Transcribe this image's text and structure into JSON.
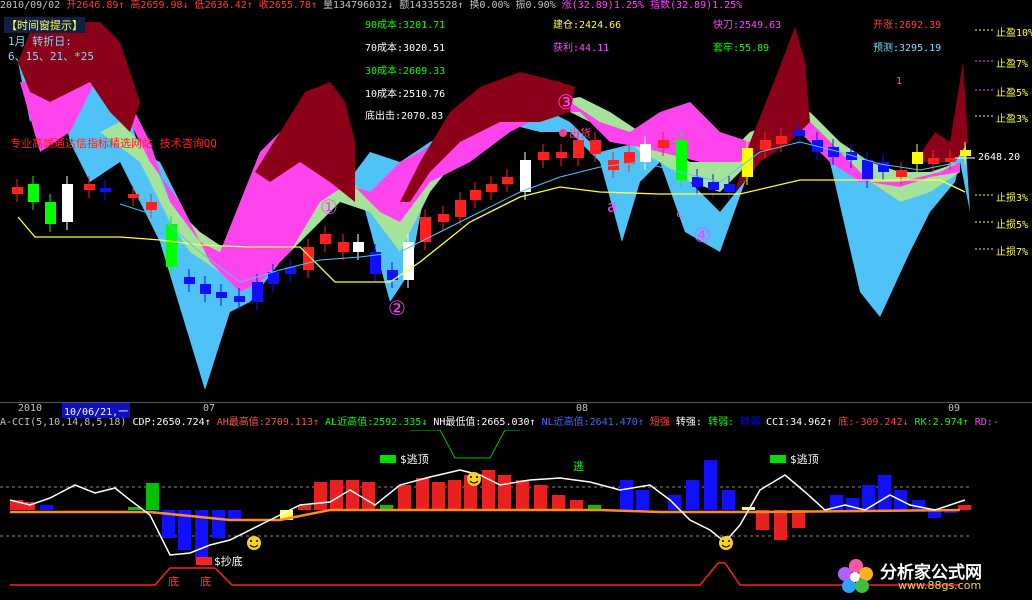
{
  "topbar": [
    {
      "text": "2010/09/02",
      "color": "#c0c0c0"
    },
    {
      "text": "开2646.89↑",
      "color": "#ff3b3b"
    },
    {
      "text": "高2659.98↓",
      "color": "#ff3b3b"
    },
    {
      "text": "低2636.42↑",
      "color": "#ff3b3b"
    },
    {
      "text": "收2655.78↑",
      "color": "#ff3b3b"
    },
    {
      "text": "量134796032↓",
      "color": "#c0c0c0"
    },
    {
      "text": "额14335528↑",
      "color": "#c0c0c0"
    },
    {
      "text": "换0.00%",
      "color": "#c0c0c0"
    },
    {
      "text": "振0.90%",
      "color": "#c0c0c0"
    },
    {
      "text": "涨(32.89)1.25%",
      "color": "#ff44ff"
    },
    {
      "text": "指数(32.89)1.25%",
      "color": "#ff44ff"
    }
  ],
  "panel": {
    "title": "【时间窗提示】",
    "line1": "1月 转折日:",
    "line2": "6、15、21、*25"
  },
  "cost": {
    "c90": "90成本:3201.71",
    "c70": "70成本:3020.51",
    "c30": "30成本:2609.33",
    "c10": "10成本:2510.76",
    "bottom": "底出击:2070.83"
  },
  "info": {
    "jiancang": "建仓:2424.66",
    "huoli": "获利:44.11",
    "kuaidao": "快刀:2549.63",
    "taolao": "套牢:55.89",
    "kaizhang": "开涨:2692.39",
    "yuce": "预测:3295.19"
  },
  "marks": {
    "stop_profit_10": "止盈10%",
    "stop_profit_7": "止盈7%",
    "stop_profit_5": "止盈5%",
    "stop_profit_3": "止盈3%",
    "current_price": "2648.20",
    "stop_loss_3": "止损3%",
    "stop_loss_5": "止损5%",
    "stop_loss_7": "止损7%",
    "digit_1": "1",
    "red_message": "专业高端通达信指标精选网站 技术咨询QQ",
    "circle1": "①",
    "circle2": "②",
    "circle3": "③",
    "circle4": "④",
    "label_a": "a",
    "label_b": "b",
    "label_c": "c",
    "chuhuo": "出货"
  },
  "dateaxis": {
    "y2010": "2010",
    "cursor": "10/06/21,一",
    "m07": "07",
    "m08": "08",
    "m09": "09"
  },
  "indicator_header": [
    {
      "text": "A-CCI(5,10,14,8,5,18)",
      "color": "#c0c0c0"
    },
    {
      "text": "CDP:2650.724↑",
      "color": "#ffffff"
    },
    {
      "text": "AH最高值:2709.113↑",
      "color": "#ff5050"
    },
    {
      "text": "AL近高值:2592.335↓",
      "color": "#00ff00"
    },
    {
      "text": "NH最低值:2665.030↑",
      "color": "#ffffff"
    },
    {
      "text": "NL近高值:2641.470↑",
      "color": "#3a6bff"
    },
    {
      "text": "短强",
      "color": "#ff4040"
    },
    {
      "text": "转强:",
      "color": "#ffffff"
    },
    {
      "text": "转弱:",
      "color": "#00ff00"
    },
    {
      "text": "转弱",
      "color": "#0000ff"
    },
    {
      "text": "CCI:34.962↑",
      "color": "#ffffff"
    },
    {
      "text": "底:-309.242↓",
      "color": "#ff4040"
    },
    {
      "text": "RK:2.974↑",
      "color": "#00ff00"
    },
    {
      "text": "RD:-",
      "color": "#ff44ff"
    }
  ],
  "indicator_labels": {
    "escape_top_1": "$逃顶",
    "escape_top_2": "$逃顶",
    "escape": "逃",
    "copy_bottom": "$抄底",
    "bottom1": "底",
    "bottom2": "底"
  },
  "logo": {
    "name": "分析家公式网",
    "url": "www.88gs.com"
  },
  "colors": {
    "up": "#ff2020",
    "down": "#1010ff",
    "crimson": "#8b0018",
    "magenta": "#ff44ee",
    "sky": "#4fc3f7",
    "lightgreen": "#a6e39a",
    "yellow": "#ffff40"
  }
}
